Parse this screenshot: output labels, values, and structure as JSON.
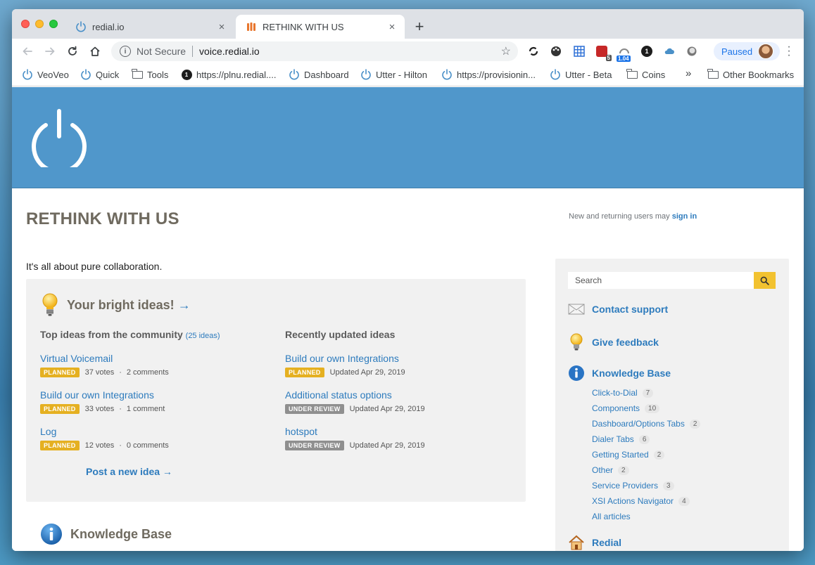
{
  "browser": {
    "tabs": [
      {
        "title": "redial.io",
        "close": "×"
      },
      {
        "title": "RETHINK WITH US",
        "close": "×"
      }
    ],
    "new_tab": "+",
    "security_label": "Not Secure",
    "url": "voice.redial.io",
    "extensions": [
      {
        "icon": "sync-icon"
      },
      {
        "icon": "palette-icon"
      },
      {
        "icon": "grid-icon"
      },
      {
        "icon": "calendar-icon",
        "badge": "5"
      },
      {
        "icon": "speed-icon",
        "badge": "1.04"
      },
      {
        "icon": "onepassword-icon",
        "label": "1"
      },
      {
        "icon": "cloud-icon"
      },
      {
        "icon": "circle-icon"
      }
    ],
    "profile_label": "Paused",
    "bookmarks": [
      {
        "label": "VeoVeo",
        "icon": "power-icon"
      },
      {
        "label": "Quick",
        "icon": "power-icon"
      },
      {
        "label": "Tools",
        "icon": "folder-icon"
      },
      {
        "label": "https://plnu.redial....",
        "icon": "onepassword-icon"
      },
      {
        "label": "Dashboard",
        "icon": "power-icon"
      },
      {
        "label": "Utter - Hilton",
        "icon": "power-icon"
      },
      {
        "label": "https://provisionin...",
        "icon": "power-icon"
      },
      {
        "label": "Utter - Beta",
        "icon": "power-icon"
      },
      {
        "label": "Coins",
        "icon": "folder-icon"
      }
    ],
    "bookmarks_overflow": "»",
    "other_bookmarks": "Other Bookmarks",
    "onepassword_glyph": "1"
  },
  "page": {
    "title": "RETHINK WITH US",
    "signin_prefix": "New and returning users may ",
    "signin_link": "sign in",
    "tagline": "It's all about pure collaboration.",
    "ideas": {
      "heading": "Your bright ideas!",
      "heading_arrow": "→",
      "top": {
        "heading": "Top ideas from the community",
        "count": "(25 ideas)",
        "items": [
          {
            "title": "Virtual Voicemail",
            "status": "PLANNED",
            "votes": "37 votes",
            "comments": "2 comments"
          },
          {
            "title": "Build our own Integrations",
            "status": "PLANNED",
            "votes": "33 votes",
            "comments": "1 comment"
          },
          {
            "title": "Log",
            "status": "PLANNED",
            "votes": "12 votes",
            "comments": "0 comments"
          }
        ]
      },
      "recent": {
        "heading": "Recently updated ideas",
        "items": [
          {
            "title": "Build our own Integrations",
            "status": "PLANNED",
            "updated": "Updated Apr 29, 2019"
          },
          {
            "title": "Additional status options",
            "status": "UNDER REVIEW",
            "updated": "Updated Apr 29, 2019"
          },
          {
            "title": "hotspot",
            "status": "UNDER REVIEW",
            "updated": "Updated Apr 29, 2019"
          }
        ]
      },
      "separator": "·",
      "post_idea": "Post a new idea →"
    },
    "knowledge_base_heading": "Knowledge Base"
  },
  "sidebar": {
    "search_placeholder": "Search",
    "contact_support": "Contact support",
    "give_feedback": "Give feedback",
    "knowledge_base": "Knowledge Base",
    "kb_items": [
      {
        "label": "Click-to-Dial",
        "count": "7"
      },
      {
        "label": "Components",
        "count": "10"
      },
      {
        "label": "Dashboard/Options Tabs",
        "count": "2"
      },
      {
        "label": "Dialer Tabs",
        "count": "6"
      },
      {
        "label": "Getting Started",
        "count": "2"
      },
      {
        "label": "Other",
        "count": "2"
      },
      {
        "label": "Service Providers",
        "count": "3"
      },
      {
        "label": "XSI Actions Navigator",
        "count": "4"
      }
    ],
    "all_articles": "All articles",
    "redial_link": "Redial"
  },
  "colors": {
    "banner": "#5097cb",
    "link": "#2d7bbd",
    "planned_badge": "#e5b021",
    "review_badge": "#8f8f8f",
    "search_button": "#f2c230"
  }
}
